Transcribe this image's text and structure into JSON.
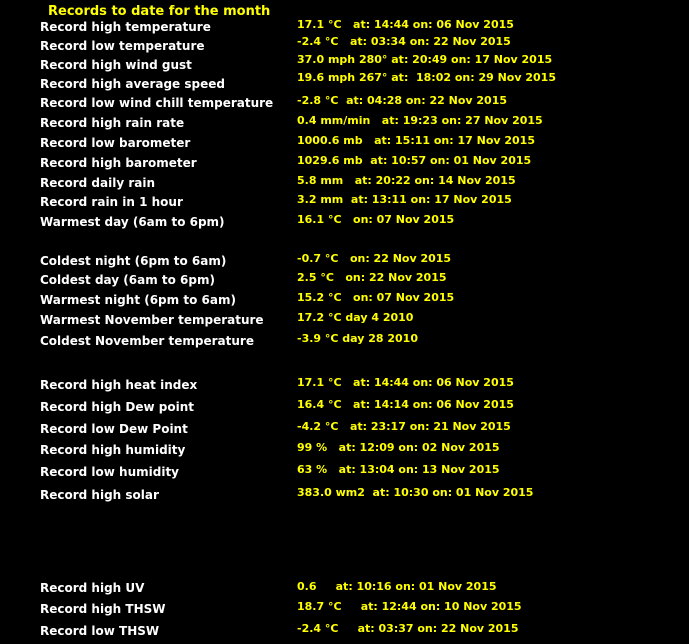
{
  "title": "Records to date for the month",
  "records": [
    {
      "label": "Record high temperature",
      "value": "17.1 °C   at: 14:44 on: 06 Nov 2015"
    },
    {
      "label": "Record low temperature",
      "value": "-2.4 °C   at: 03:34 on: 22 Nov 2015"
    },
    {
      "label": "Record high wind gust",
      "value": "37.0 mph 280° at: 20:49 on: 17 Nov 2015"
    },
    {
      "label": "Record high average speed",
      "value": "19.6 mph 267° at:  18:02 on: 29 Nov 2015"
    },
    {
      "label": "Record low wind chill temperature",
      "value": "-2.8 °C  at: 04:28 on: 22 Nov 2015"
    },
    {
      "label": "Record high rain rate",
      "value": "0.4 mm/min   at: 19:23 on: 27 Nov 2015"
    },
    {
      "label": "Record low barometer",
      "value": "1000.6 mb   at: 15:11 on: 17 Nov 2015"
    },
    {
      "label": "Record high barometer",
      "value": "1029.6 mb  at: 10:57 on: 01 Nov 2015"
    },
    {
      "label": "Record daily rain",
      "value": "5.8 mm   at: 20:22 on: 14 Nov 2015"
    },
    {
      "label": "Record rain in 1 hour",
      "value": "3.2 mm  at: 13:11 on: 17 Nov 2015"
    },
    {
      "label": "Warmest day (6am to 6pm)",
      "value": "16.1 °C   on: 07 Nov 2015"
    },
    {
      "label": "Coldest night (6pm to 6am)",
      "value": "-0.7 °C   on: 22 Nov 2015"
    },
    {
      "label": "Coldest day (6am to 6pm)",
      "value": "2.5 °C   on: 22 Nov 2015"
    },
    {
      "label": "Warmest night (6pm to 6am)",
      "value": "15.2 °C   on: 07 Nov 2015"
    },
    {
      "label": "Warmest November temperature",
      "value": "17.2 °C day 4 2010"
    },
    {
      "label": "Coldest November temperature",
      "value": "-3.9 °C day 28 2010"
    },
    {
      "label": "Record high heat index",
      "value": "17.1 °C   at: 14:44 on: 06 Nov 2015"
    },
    {
      "label": "Record high Dew point",
      "value": "16.4 °C   at: 14:14 on: 06 Nov 2015"
    },
    {
      "label": "Record low Dew Point",
      "value": "-4.2 °C   at: 23:17 on: 21 Nov 2015"
    },
    {
      "label": "Record high humidity",
      "value": "99 %   at: 12:09 on: 02 Nov 2015"
    },
    {
      "label": "Record low humidity",
      "value": "63 %   at: 13:04 on: 13 Nov 2015"
    },
    {
      "label": "Record high solar",
      "value": "383.0 wm2  at: 10:30 on: 01 Nov 2015"
    },
    {
      "label": "Record high UV",
      "value": "0.6     at: 10:16 on: 01 Nov 2015"
    },
    {
      "label": "Record high THSW",
      "value": "18.7 °C     at: 12:44 on: 10 Nov 2015"
    },
    {
      "label": "Record low THSW",
      "value": "-2.4 °C     at: 03:37 on: 22 Nov 2015"
    }
  ]
}
